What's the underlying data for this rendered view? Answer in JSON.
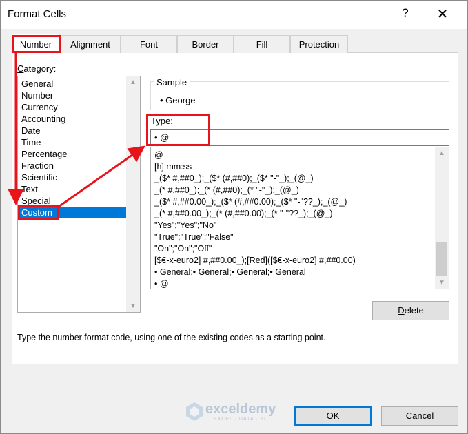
{
  "window": {
    "title": "Format Cells",
    "help": "?",
    "close": "✕"
  },
  "tabs": [
    {
      "label": "Number"
    },
    {
      "label": "Alignment"
    },
    {
      "label": "Font"
    },
    {
      "label": "Border"
    },
    {
      "label": "Fill"
    },
    {
      "label": "Protection"
    }
  ],
  "category": {
    "label_first": "C",
    "label_rest": "ategory:",
    "items": [
      "General",
      "Number",
      "Currency",
      "Accounting",
      "Date",
      "Time",
      "Percentage",
      "Fraction",
      "Scientific",
      "Text",
      "Special",
      "Custom"
    ],
    "selected": "Custom"
  },
  "sample": {
    "label": "Sample",
    "value": "• George"
  },
  "type": {
    "label_first": "T",
    "label_rest": "ype:",
    "value": "• @",
    "items": [
      "@",
      "[h]:mm:ss",
      "_($* #,##0_);_($* (#,##0);_($* \"-\"_);_(@_)",
      "_(* #,##0_);_(* (#,##0);_(* \"-\"_);_(@_)",
      "_($* #,##0.00_);_($* (#,##0.00);_($* \"-\"??_);_(@_)",
      "_(* #,##0.00_);_(* (#,##0.00);_(* \"-\"??_);_(@_)",
      "\"Yes\";\"Yes\";\"No\"",
      "\"True\";\"True\";\"False\"",
      "\"On\";\"On\";\"Off\"",
      "[$€-x-euro2] #,##0.00_);[Red]([$€-x-euro2] #,##0.00)",
      "• General;• General;• General;• General",
      "• @"
    ]
  },
  "buttons": {
    "delete_first": "D",
    "delete_rest": "elete",
    "ok": "OK",
    "cancel": "Cancel"
  },
  "hint": "Type the number format code, using one of the existing codes as a starting point.",
  "watermark": {
    "name": "exceldemy",
    "tagline": "EXCEL · DATA · BI"
  },
  "colors": {
    "selection": "#0078d7",
    "annotation": "#e8141c"
  },
  "icons": {
    "up": "▲",
    "down": "▼"
  }
}
